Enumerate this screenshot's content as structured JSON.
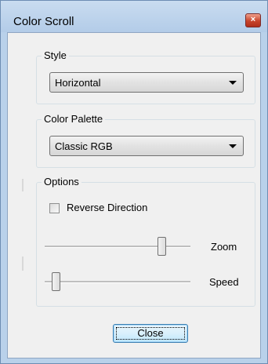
{
  "window": {
    "title": "Color Scroll",
    "close_glyph": "×"
  },
  "style_group": {
    "label": "Style",
    "selected": "Horizontal"
  },
  "palette_group": {
    "label": "Color Palette",
    "selected": "Classic RGB"
  },
  "options_group": {
    "label": "Options",
    "reverse_label": "Reverse Direction",
    "reverse_checked": false,
    "zoom_label": "Zoom",
    "zoom_level": 0.82,
    "speed_label": "Speed",
    "speed_level": 0.05
  },
  "close_button": {
    "label": "Close"
  },
  "colors": {
    "title_bar": "#b9d1ea",
    "client_bg": "#f0f0f0",
    "close_red": "#c8442b"
  }
}
